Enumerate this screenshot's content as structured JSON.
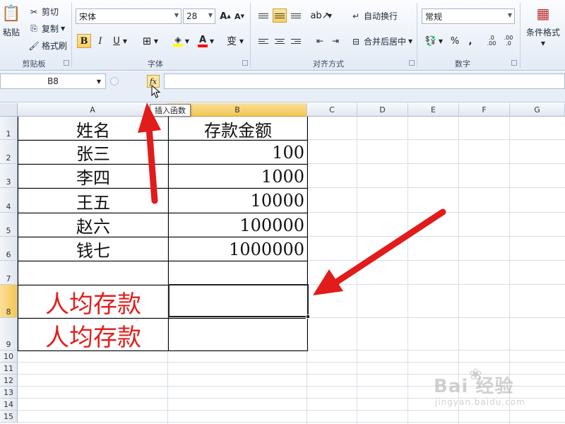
{
  "ribbon": {
    "clipboard": {
      "paste": "粘贴",
      "cut": "剪切",
      "copy": "复制",
      "format_painter": "格式刷",
      "label": "剪贴板"
    },
    "font": {
      "name": "宋体",
      "size": "28",
      "label": "字体",
      "bold": "B",
      "italic": "I",
      "underline": "U",
      "font_color_glyph": "A",
      "wen": "变"
    },
    "alignment": {
      "wrap_text": "自动换行",
      "merge_center": "合并后居中",
      "label": "对齐方式"
    },
    "number": {
      "format": "常规",
      "percent": "%",
      "comma": ",",
      "inc_decimal": ".0 .00",
      "dec_decimal": ".00 .0",
      "label": "数字"
    },
    "styles": {
      "conditional_format": "条件格式"
    }
  },
  "formula_bar": {
    "name_box": "B8",
    "fx": "fx",
    "tooltip": "插入函数"
  },
  "columns": [
    "A",
    "B",
    "C",
    "D",
    "E",
    "F",
    "G"
  ],
  "rows": [
    "1",
    "2",
    "3",
    "4",
    "5",
    "6",
    "7",
    "8",
    "9",
    "10",
    "11",
    "12",
    "13",
    "14",
    "15"
  ],
  "table": {
    "header": {
      "name": "姓名",
      "amount": "存款金额"
    },
    "records": [
      {
        "name": "张三",
        "amount": "100"
      },
      {
        "name": "李四",
        "amount": "1000"
      },
      {
        "name": "王五",
        "amount": "10000"
      },
      {
        "name": "赵六",
        "amount": "100000"
      },
      {
        "name": "钱七",
        "amount": "1000000"
      }
    ],
    "avg_label_1": "人均存款",
    "avg_label_2": "人均存款"
  },
  "watermark": {
    "brand": "Bai 经验",
    "url": "jingyan.baidu.com"
  },
  "colors": {
    "selection": "#f3c653",
    "arrow": "#e21b1b",
    "label_red": "#e02020"
  }
}
